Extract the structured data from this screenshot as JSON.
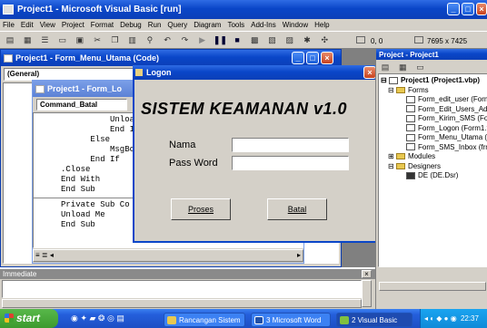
{
  "app": {
    "title": "Project1 - Microsoft Visual Basic [run]"
  },
  "menu": [
    "File",
    "Edit",
    "View",
    "Project",
    "Format",
    "Debug",
    "Run",
    "Query",
    "Diagram",
    "Tools",
    "Add-Ins",
    "Window",
    "Help"
  ],
  "toolbar": {
    "position": "0, 0",
    "size": "7695 x 7425"
  },
  "code_back": {
    "title": "Project1 - Form_Menu_Utama (Code)",
    "object_combo": "(General)"
  },
  "code_front": {
    "title": "Project1 - Form_Lo",
    "combo": "Command_Batal",
    "lines_top": [
      "          Unload",
      "          End If",
      "      Else",
      "          MsgBox",
      "      End If",
      ".Close",
      "End With",
      "End Sub"
    ],
    "lines_bottom": [
      "Private Sub Co",
      "Unload Me",
      "End Sub"
    ]
  },
  "logon": {
    "title": "Logon",
    "heading": "SISTEM KEAMANAN v1.0",
    "nama_label": "Nama",
    "nama_value": "",
    "pass_label": "Pass Word",
    "pass_value": "",
    "proses_label": "Proses",
    "batal_label": "Batal"
  },
  "project_panel": {
    "title": "Project - Project1",
    "root": "Project1 (Project1.vbp)",
    "forms_folder": "Forms",
    "forms": [
      "Form_edit_user (Form",
      "Form_Edit_Users_Adn",
      "Form_Kirim_SMS (Forr",
      "Form_Logon (Form1.f",
      "Form_Menu_Utama (F",
      "Form_SMS_Inbox (frm"
    ],
    "modules_folder": "Modules",
    "designers_folder": "Designers",
    "designer_item": "DE (DE.Dsr)"
  },
  "immediate": {
    "title": "Immediate"
  },
  "taskbar": {
    "start": "start",
    "items": [
      "Rancangan Sistem",
      "3 Microsoft Word",
      "2 Visual Basic"
    ],
    "clock": "22:37"
  },
  "colors": {
    "xp_blue": "#0a46c8",
    "taskbar": "#245edb",
    "start_green": "#3c9a2e"
  }
}
